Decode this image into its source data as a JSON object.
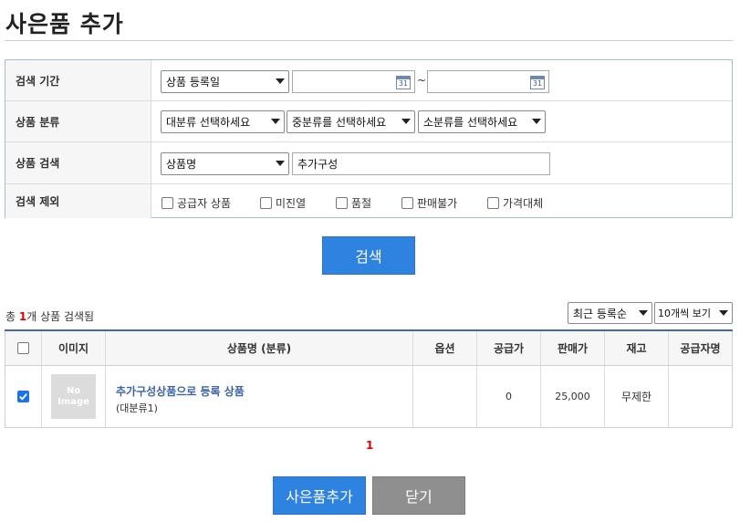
{
  "page": {
    "title": "사은품 추가"
  },
  "search": {
    "period_label": "검색 기간",
    "period_type": "상품 등록일",
    "date_from": "",
    "date_to": "",
    "date_sep": "~",
    "calendar_icon_text": "31",
    "category_label": "상품 분류",
    "cat_large": "대분류 선택하세요",
    "cat_medium": "중분류를 선택하세요",
    "cat_small": "소분류를 선택하세요",
    "product_label": "상품 검색",
    "product_field": "상품명",
    "product_query": "추가구성",
    "exclude_label": "검색 제외",
    "exclude_options": [
      "공급자 상품",
      "미진열",
      "품절",
      "판매불가",
      "가격대체"
    ],
    "button": "검색"
  },
  "results": {
    "prefix": "총 ",
    "count": "1",
    "suffix": "개 상품 검색됨",
    "sort": "최근 등록순",
    "per_page": "10개씩 보기"
  },
  "table": {
    "headers": [
      "이미지",
      "상품명 (분류)",
      "옵션",
      "공급가",
      "판매가",
      "재고",
      "공급자명"
    ],
    "rows": [
      {
        "checked": true,
        "image_text_1": "No",
        "image_text_2": "Image",
        "name": "추가구성상품으로 등록 상품",
        "category": "(대분류1)",
        "option": "",
        "supply_price": "0",
        "sale_price": "25,000",
        "stock": "무제한",
        "supplier": ""
      }
    ]
  },
  "pagination": {
    "current": "1"
  },
  "buttons": {
    "add": "사은품추가",
    "close": "닫기"
  },
  "colors": {
    "primary": "#2f83e0",
    "secondary": "#8f8f8f",
    "accent_red": "#dd0000",
    "link": "#3b63a8"
  }
}
